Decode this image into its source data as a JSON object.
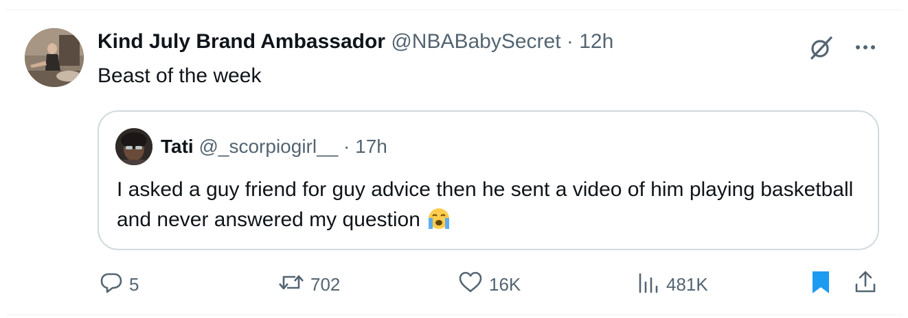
{
  "tweet": {
    "author_name": "Kind July Brand Ambassador",
    "handle": "@NBABabySecret",
    "separator": "·",
    "time": "12h",
    "text": "Beast of the week"
  },
  "quote": {
    "author_name": "Tati",
    "handle": "@_scorpiogirl__",
    "separator": "·",
    "time": "17h",
    "text": "I asked a guy friend for guy advice then he sent a video of him playing basketball and never answered my question",
    "emoji": "loudly-crying-face"
  },
  "actions": {
    "replies": "5",
    "reposts": "702",
    "likes": "16K",
    "views": "481K"
  },
  "icons": {
    "grok": "grok-icon",
    "more": "more-icon",
    "reply": "reply-icon",
    "repost": "repost-icon",
    "like": "like-icon",
    "views": "views-icon",
    "bookmark": "bookmark-icon",
    "share": "share-icon"
  },
  "colors": {
    "text": "#0f1419",
    "muted": "#536471",
    "border": "#cfd9de",
    "bookmark_active": "#1d9bf0"
  }
}
